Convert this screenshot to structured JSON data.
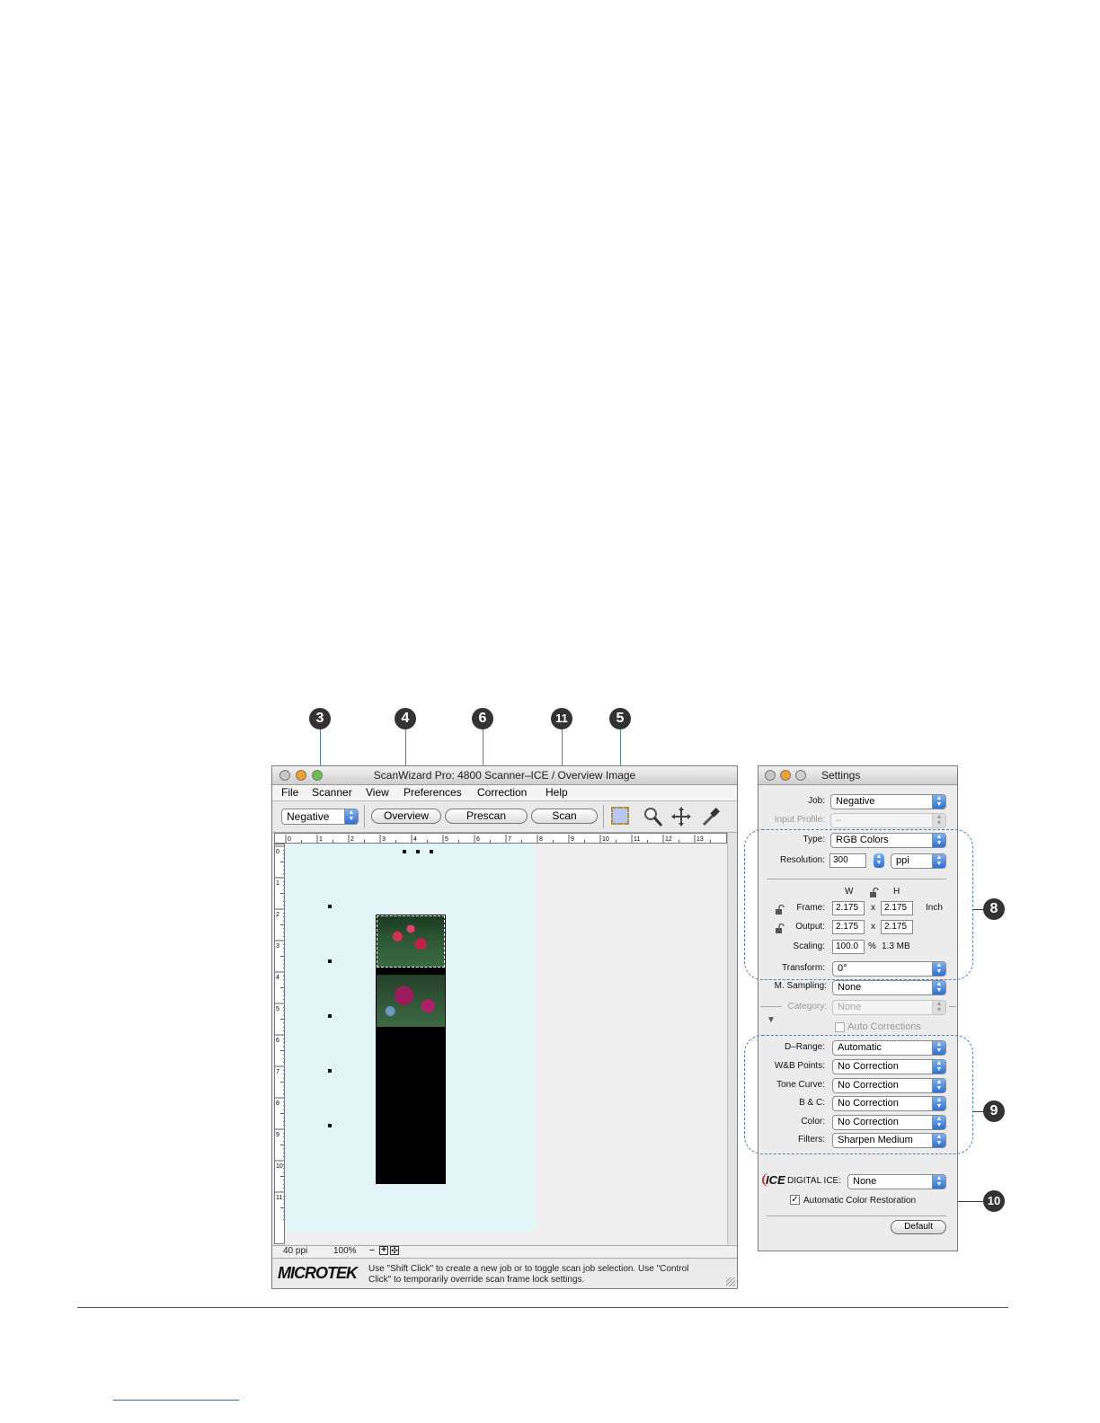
{
  "callouts": [
    "3",
    "4",
    "6",
    "11",
    "5",
    "8",
    "9",
    "10"
  ],
  "main_window": {
    "title": "ScanWizard Pro: 4800 Scanner–ICE / Overview Image",
    "menu": [
      "File",
      "Scanner",
      "View",
      "Preferences",
      "Correction",
      "Help"
    ],
    "job_popup": "Negative",
    "buttons": {
      "overview": "Overview",
      "prescan": "Prescan",
      "scan": "Scan"
    },
    "ruler_top": [
      "0",
      "1",
      "2",
      "3",
      "4",
      "5",
      "6",
      "7",
      "8",
      "9",
      "10",
      "11",
      "12",
      "13"
    ],
    "ruler_left": [
      "0",
      "1",
      "2",
      "3",
      "4",
      "5",
      "6",
      "7",
      "8",
      "9",
      "10",
      "11"
    ],
    "status": {
      "resolution": "40 ppi",
      "zoom": "100%"
    },
    "logo": "MICROTEK",
    "help_text_1": "Use \"Shift Click\"  to create a new job or to toggle scan job selection. Use \"Control",
    "help_text_2": "Click\" to temporarily override scan frame lock settings."
  },
  "settings": {
    "title": "Settings",
    "job_label": "Job:",
    "job_value": "Negative",
    "input_profile_label": "Input Profile:",
    "input_profile_value": "–",
    "type_label": "Type:",
    "type_value": "RGB Colors",
    "resolution_label": "Resolution:",
    "resolution_value": "300",
    "resolution_unit": "ppi",
    "col_w": "W",
    "col_h": "H",
    "frame_label": "Frame:",
    "frame_w": "2.175",
    "frame_h": "2.175",
    "unit": "Inch",
    "output_label": "Output:",
    "output_w": "2.175",
    "output_h": "2.175",
    "times": "x",
    "scaling_label": "Scaling:",
    "scaling_value": "100.0",
    "percent": "%",
    "file_size": "1.3 MB",
    "transform_label": "Transform:",
    "transform_value": "0°",
    "msampling_label": "M. Sampling:",
    "msampling_value": "None",
    "category_label": "Category:",
    "category_value": "None",
    "auto_corrections": "Auto Corrections",
    "drange_label": "D–Range:",
    "drange_value": "Automatic",
    "wb_label": "W&B Points:",
    "wb_value": "No Correction",
    "tone_label": "Tone Curve:",
    "tone_value": "No Correction",
    "bc_label": "B & C:",
    "bc_value": "No Correction",
    "color_label": "Color:",
    "color_value": "No Correction",
    "filters_label": "Filters:",
    "filters_value": "Sharpen Medium",
    "ice_logo": "ICE",
    "ice_label": "DIGITAL ICE:",
    "ice_value": "None",
    "acr_label": "Automatic Color Restoration",
    "default_button": "Default"
  },
  "colors": {
    "accent_blue": "#2d6fd6",
    "callout_line": "#4a7fc0",
    "preview_bg": "#e3f5f6"
  }
}
